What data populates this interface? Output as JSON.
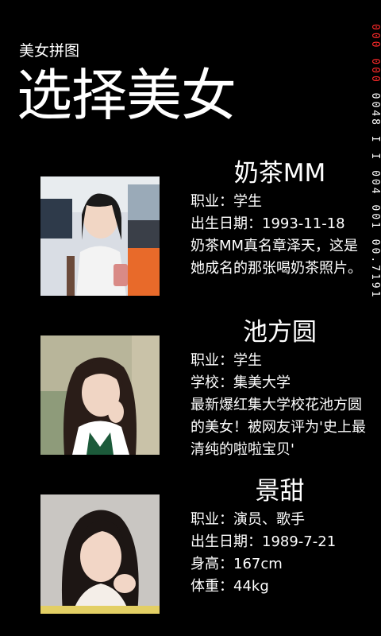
{
  "app": {
    "title": "美女拼图",
    "page_title": "选择美女"
  },
  "debug": {
    "red_text": "000 000",
    "white_text": "0048 I I 004 001 00.7191"
  },
  "items": [
    {
      "name": "奶茶MM",
      "lines": [
        "职业：学生",
        "出生日期：1993-11-18",
        "奶茶MM真名章泽天，这是她成名的那张喝奶茶照片。"
      ]
    },
    {
      "name": "池方圆",
      "lines": [
        "职业：学生",
        "学校：集美大学",
        "最新爆红集大学校花池方圆的美女！被网友评为'史上最清纯的啦啦宝贝'"
      ]
    },
    {
      "name": "景甜",
      "lines": [
        "职业：演员、歌手",
        "出生日期：1989-7-21",
        "身高：167cm",
        "体重：44kg"
      ]
    }
  ]
}
